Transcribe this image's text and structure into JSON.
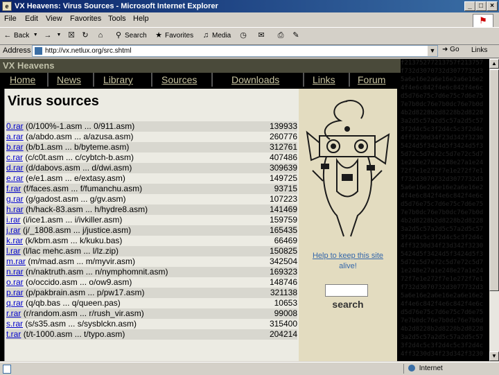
{
  "window": {
    "title": "VX Heavens: Virus Sources - Microsoft Internet Explorer",
    "icon_label": "e",
    "buttons": [
      "_",
      "□",
      "×"
    ]
  },
  "menu": [
    "File",
    "Edit",
    "View",
    "Favorites",
    "Tools",
    "Help"
  ],
  "toolbar": {
    "back": "Back",
    "search": "Search",
    "favorites": "Favorites",
    "media": "Media",
    "icons": [
      "back-arrow-icon",
      "forward-arrow-icon",
      "stop-icon",
      "refresh-icon",
      "home-icon",
      "search-icon",
      "favorites-icon",
      "media-icon",
      "history-icon",
      "mail-icon",
      "print-icon",
      "edit-icon"
    ]
  },
  "address": {
    "label": "Address",
    "url": "http://vx.netlux.org/src.shtml",
    "go": "Go",
    "links": "Links"
  },
  "site": {
    "header": "VX Heavens",
    "nav": [
      "Home",
      "News",
      "Library",
      "Sources",
      "Downloads",
      "Links",
      "Forum"
    ],
    "page_title": "Virus sources",
    "files": [
      {
        "link": "0.rar",
        "desc": "(0/100%-1.asm ... 0/911.asm)",
        "size": "139933"
      },
      {
        "link": "a.rar",
        "desc": "(a/abdo.asm ... a/azusa.asm)",
        "size": "260776"
      },
      {
        "link": "b.rar",
        "desc": "(b/b1.asm ... b/byteme.asm)",
        "size": "312761"
      },
      {
        "link": "c.rar",
        "desc": "(c/c0t.asm ... c/cybtch-b.asm)",
        "size": "407486"
      },
      {
        "link": "d.rar",
        "desc": "(d/dabovs.asm ... d/dwi.asm)",
        "size": "309639"
      },
      {
        "link": "e.rar",
        "desc": "(e/e1.asm ... e/extasy.asm)",
        "size": "149725"
      },
      {
        "link": "f.rar",
        "desc": "(f/faces.asm ... f/fumanchu.asm)",
        "size": "93715"
      },
      {
        "link": "g.rar",
        "desc": "(g/gadost.asm ... g/gv.asm)",
        "size": "107223"
      },
      {
        "link": "h.rar",
        "desc": "(h/hack-83.asm ... h/hydre8.asm)",
        "size": "141469"
      },
      {
        "link": "i.rar",
        "desc": "(i/ice1.asm ... i/ivkiller.asm)",
        "size": "159759"
      },
      {
        "link": "j.rar",
        "desc": "(j/_1808.asm ... j/justice.asm)",
        "size": "165435"
      },
      {
        "link": "k.rar",
        "desc": "(k/kbm.asm ... k/kuku.bas)",
        "size": "66469"
      },
      {
        "link": "l.rar",
        "desc": "(l/lac mehc.asm ... l/lz.zip)",
        "size": "150825"
      },
      {
        "link": "m.rar",
        "desc": "(m/mad.asm ... m/myvir.asm)",
        "size": "342504"
      },
      {
        "link": "n.rar",
        "desc": "(n/naktruth.asm ... n/nymphomnit.asm)",
        "size": "169323"
      },
      {
        "link": "o.rar",
        "desc": "(o/occido.asm ... o/ow9.asm)",
        "size": "148746"
      },
      {
        "link": "p.rar",
        "desc": "(p/pakbrain.asm ... p/pw17.asm)",
        "size": "321138"
      },
      {
        "link": "q.rar",
        "desc": "(q/qb.bas ... q/queen.pas)",
        "size": "10653"
      },
      {
        "link": "r.rar",
        "desc": "(r/random.asm ... r/rush_vir.asm)",
        "size": "99008"
      },
      {
        "link": "s.rar",
        "desc": "(s/s35.asm ... s/sysblckn.asm)",
        "size": "315400"
      },
      {
        "link": "t.rar",
        "desc": "(t/t-1000.asm ... t/typo.asm)",
        "size": "204214"
      }
    ],
    "help_link": "Help to keep this site",
    "help_text": "alive!",
    "search_label": "search"
  },
  "hex_background": "f21375277213757f213757\nf732d3070732d3077732d3\n5a6e16e2a6e16e2a6e16e2\n4f4e6c842f4e6c842f4e6c\nd5d76e75c7d6e75c7d6e75\n7e7b0dc76e7b0dc76e7b0d\n4b2d8228b2d8228b2d8228\n3a2d5c57a2d5c57a2d5c57\n3f2d4c5c3f2d4c5c3f2d4c\n4ff3230d34f23d342f3230\n5424d5f3424d5f3424d5f3\n5d72c5d7e72c5d7e72c5d7\n1e248e27a1e248e27a1e24\n72f7e1e272f7e1e272f7e1\nf732d3070732d3077732d3\n5a6e16e2a6e16e2a6e16e2\n4f4e6c842f4e6c842f4e6c\nd5d76e75c7d6e75c7d6e75\n7e7b0dc76e7b0dc76e7b0d\n4b2d8228b2d8228b2d8228\n3a2d5c57a2d5c57a2d5c57\n3f2d4c5c3f2d4c5c3f2d4c\n4ff3230d34f23d342f3230\n5424d5f3424d5f3424d5f3\n5d72c5d7e72c5d7e72c5d7\n1e248e27a1e248e27a1e24\n72f7e1e272f7e1e272f7e1\nf732d3070732d3077732d3\n5a6e16e2a6e16e2a6e16e2\n4f4e6c842f4e6c842f4e6c\nd5d76e75c7d6e75c7d6e75\n7e7b0dc76e7b0dc76e7b0d\n4b2d8228b2d8228b2d8228\n3a2d5c57a2d5c57a2d5c57\n3f2d4c5c3f2d4c5c3f2d4c\n4ff3230d34f23d342f3230",
  "status": {
    "zone": "Internet"
  },
  "colors": {
    "titlebar": "#0a246a",
    "link": "#0000cc",
    "nav_text": "#c8c4a0",
    "content_bg": "#ecebe3",
    "sidebar_bg": "#e3dcc0"
  }
}
